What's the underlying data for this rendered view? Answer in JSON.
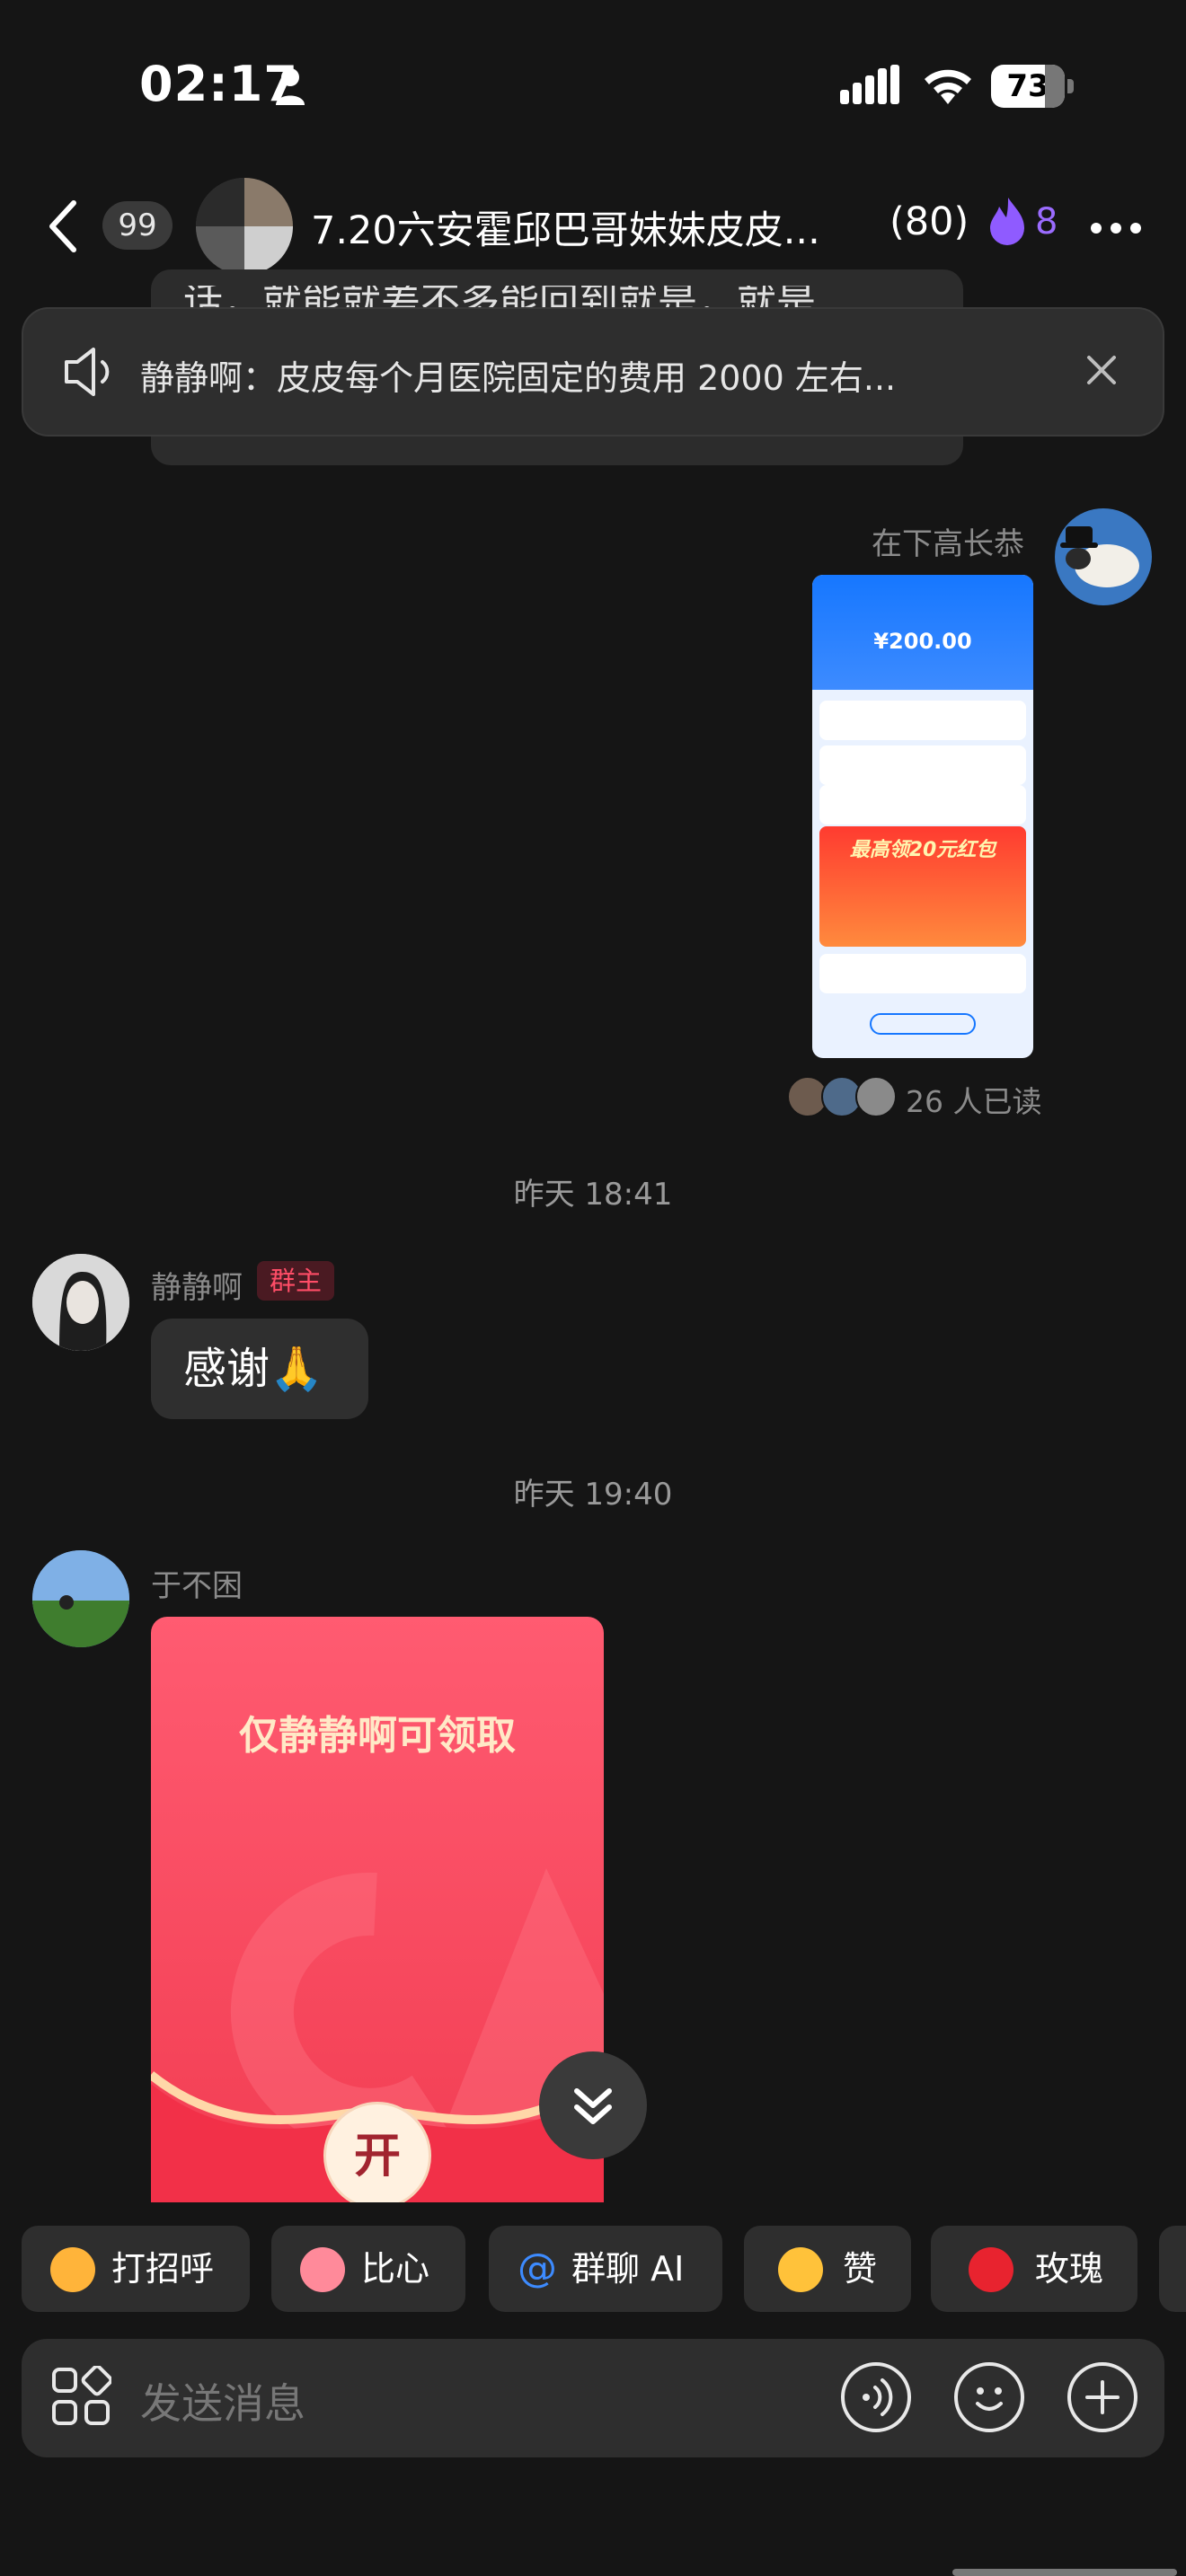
{
  "status_bar": {
    "time": "02:17",
    "battery": "73"
  },
  "header": {
    "unread_count": "99",
    "title": "7.20六安霍邱巴哥妹妹皮皮...",
    "member_count": "(80)",
    "fire_count": "8"
  },
  "previous_message_fragment": "话，就能就差不多能回到就是，就是",
  "announcement": {
    "text": "静静啊：皮皮每个月医院固定的费用 2000 左右..."
  },
  "messages": {
    "m1": {
      "sender": "在下高长恭",
      "screenshot_amount": "¥200.00",
      "screenshot_banner": "最高领20元红包",
      "read_status": "26 人已读"
    },
    "divider1": "昨天 18:41",
    "m2": {
      "sender": "静静啊",
      "tag": "群主",
      "text": "感谢🙏"
    },
    "divider2": "昨天 19:40",
    "m3": {
      "sender": "于不困",
      "packet_title": "仅静静啊可领取",
      "packet_button": "开"
    }
  },
  "quick_replies": [
    "打招呼",
    "比心",
    "群聊 AI",
    "赞",
    "玫瑰"
  ],
  "input": {
    "placeholder": "发送消息"
  },
  "colors": {
    "background": "#151515",
    "bubble": "#2f2f2f",
    "owner_tag": "#ff4d67",
    "fire": "#9b6cff",
    "red_packet": "#f23d52"
  }
}
